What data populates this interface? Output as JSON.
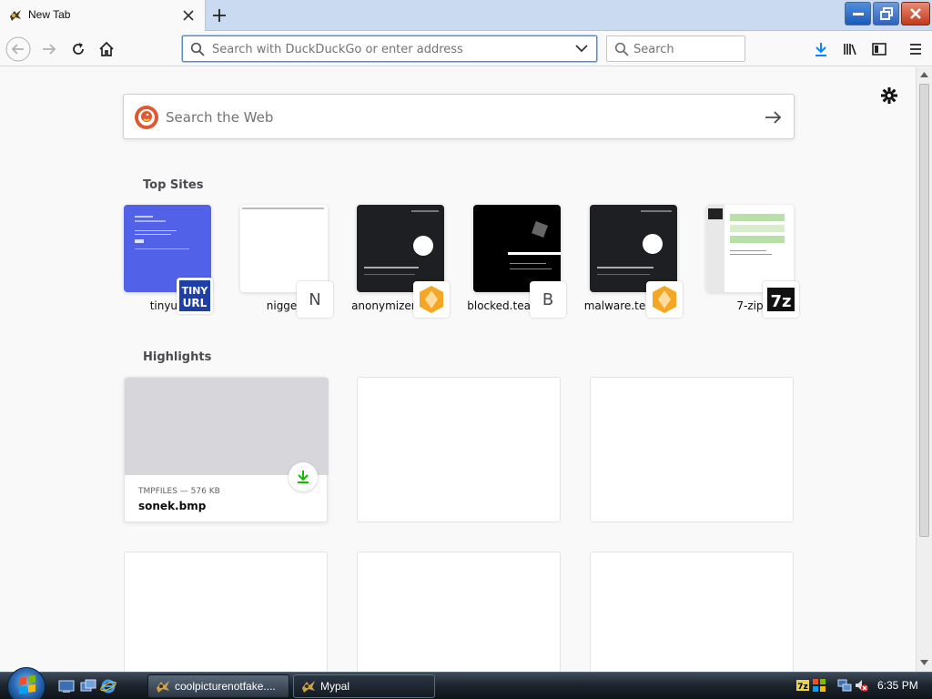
{
  "browser": {
    "tab": {
      "title": "New Tab"
    },
    "urlbar": {
      "placeholder": "Search with DuckDuckGo or enter address"
    },
    "searchbar": {
      "placeholder": "Search"
    }
  },
  "newtab": {
    "web_search": {
      "placeholder": "Search the Web"
    },
    "top_sites_title": "Top Sites",
    "top_sites": [
      {
        "label": "tinyurl",
        "icon_text": "TINY URL"
      },
      {
        "label": "nigger",
        "icon_text": "N"
      },
      {
        "label": "anonymizer.test...",
        "icon_text": ""
      },
      {
        "label": "blocked.teams.c...",
        "icon_text": "B"
      },
      {
        "label": "malware.testcat...",
        "icon_text": ""
      },
      {
        "label": "7-zip",
        "icon_text": "7z"
      }
    ],
    "highlights_title": "Highlights",
    "highlights": [
      {
        "meta": "TMPFILES — 576 KB",
        "title": "sonek.bmp"
      }
    ]
  },
  "taskbar": {
    "buttons": [
      {
        "label": "coolpicturenotfake....",
        "active": false
      },
      {
        "label": "Mypal",
        "active": true
      }
    ],
    "clock": "6:35 PM"
  },
  "colors": {
    "accent": "#0a84ff",
    "download_green": "#12bc00",
    "tinyurl_blue": "#5262e8"
  }
}
